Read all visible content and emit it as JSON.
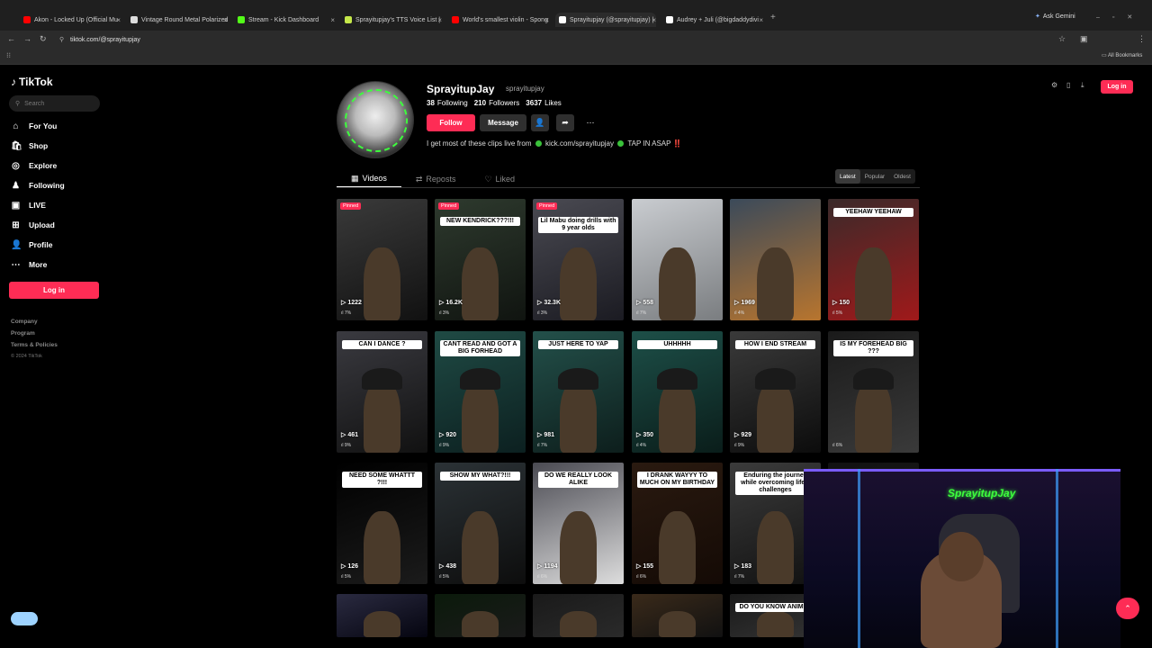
{
  "browser": {
    "tabs": [
      {
        "title": "Akon - Locked Up (Official Mu",
        "color": "#ff0000"
      },
      {
        "title": "Vintage Round Metal Polarized",
        "color": "#dddddd"
      },
      {
        "title": "Stream - Kick Dashboard",
        "color": "#53fc18"
      },
      {
        "title": "Sprayitupjay's TTS Voice List | T",
        "color": "#c5e84a"
      },
      {
        "title": "World's smallest violin - Spong",
        "color": "#ff0000"
      },
      {
        "title": "Sprayitupjay (@sprayitupjay) |",
        "color": "#ffffff"
      },
      {
        "title": "Audrey + Juli (@bigdaddydivi",
        "color": "#ffffff"
      }
    ],
    "ask_gemini": "Ask Gemini",
    "url": "tiktok.com/@sprayitupjay",
    "all_bookmarks": "All Bookmarks"
  },
  "sidebar": {
    "logo": "TikTok",
    "search_placeholder": "Search",
    "nav": [
      {
        "label": "For You",
        "icon": "home-icon"
      },
      {
        "label": "Shop",
        "icon": "shop-icon"
      },
      {
        "label": "Explore",
        "icon": "compass-icon"
      },
      {
        "label": "Following",
        "icon": "user-icon"
      },
      {
        "label": "LIVE",
        "icon": "live-icon"
      },
      {
        "label": "Upload",
        "icon": "upload-icon"
      },
      {
        "label": "Profile",
        "icon": "profile-icon"
      },
      {
        "label": "More",
        "icon": "more-icon"
      }
    ],
    "login": "Log in",
    "footer": [
      "Company",
      "Program",
      "Terms & Policies"
    ],
    "copyright": "© 2024 TikTok"
  },
  "profile": {
    "name": "SprayitupJay",
    "handle": "sprayitupjay",
    "following": "38",
    "following_label": "Following",
    "followers": "210",
    "followers_label": "Followers",
    "likes": "3637",
    "likes_label": "Likes",
    "follow": "Follow",
    "message": "Message",
    "bio_a": "I get most of these clips live from",
    "bio_b": "kick.com/sprayitupjay",
    "bio_c": "TAP IN ASAP ‼️",
    "tabs": [
      "Videos",
      "Reposts",
      "Liked"
    ],
    "sort": [
      "Latest",
      "Popular",
      "Oldest"
    ],
    "login_top": "Log in"
  },
  "videos": [
    {
      "pinned": true,
      "caption": "",
      "views": "1222",
      "sub": "7%"
    },
    {
      "pinned": true,
      "caption": "NEW KENDRICK???!!!",
      "views": "16.2K",
      "sub": "3%"
    },
    {
      "pinned": true,
      "caption": "Lil Mabu doing drills with 9 year olds",
      "views": "32.3K",
      "sub": "3%"
    },
    {
      "pinned": false,
      "caption": "",
      "views": "558",
      "sub": "7%"
    },
    {
      "pinned": false,
      "caption": "",
      "views": "1969",
      "sub": "4%"
    },
    {
      "pinned": false,
      "caption": "YEEHAW YEEHAW",
      "views": "150",
      "sub": "5%"
    },
    {
      "pinned": false,
      "caption": "CAN I DANCE ?",
      "views": "461",
      "sub": "9%"
    },
    {
      "pinned": false,
      "caption": "CANT READ AND GOT A BIG FORHEAD",
      "views": "920",
      "sub": "9%"
    },
    {
      "pinned": false,
      "caption": "JUST HERE TO YAP",
      "views": "981",
      "sub": "7%"
    },
    {
      "pinned": false,
      "caption": "UHHHHH",
      "views": "350",
      "sub": "4%"
    },
    {
      "pinned": false,
      "caption": "HOW I END STREAM",
      "views": "929",
      "sub": "9%"
    },
    {
      "pinned": false,
      "caption": "IS MY FOREHEAD BIG ???",
      "views": "",
      "sub": "6%"
    },
    {
      "pinned": false,
      "caption": "NEED SOME WHATTT ?!!!",
      "views": "126",
      "sub": "5%"
    },
    {
      "pinned": false,
      "caption": "SHOW MY WHAT?!!!",
      "views": "438",
      "sub": "5%"
    },
    {
      "pinned": false,
      "caption": "DO WE REALLY LOOK ALIKE",
      "views": "1194",
      "sub": "6%"
    },
    {
      "pinned": false,
      "caption": "I DRANK WAYYY TO MUCH ON MY BIRTHDAY",
      "views": "155",
      "sub": "6%"
    },
    {
      "pinned": false,
      "caption": "Enduring the journey while overcoming life's challenges",
      "views": "183",
      "sub": "7%"
    },
    {
      "pinned": false,
      "caption": "",
      "views": "",
      "sub": ""
    },
    {
      "pinned": false,
      "caption": "",
      "views": "",
      "sub": ""
    },
    {
      "pinned": false,
      "caption": "",
      "views": "",
      "sub": ""
    },
    {
      "pinned": false,
      "caption": "",
      "views": "",
      "sub": ""
    },
    {
      "pinned": false,
      "caption": "",
      "views": "",
      "sub": ""
    },
    {
      "pinned": false,
      "caption": "DO YOU KNOW ANIME?",
      "views": "",
      "sub": ""
    }
  ],
  "webcam": {
    "sign": "SprayitupJay"
  },
  "pinned_label": "Pinned"
}
